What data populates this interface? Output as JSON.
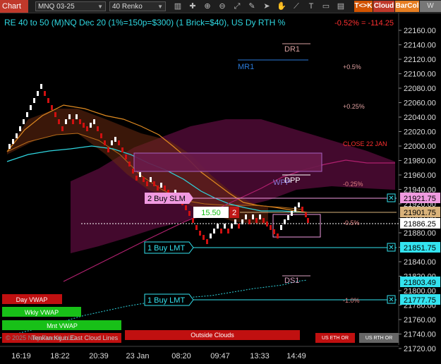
{
  "toolbar": {
    "chart_label": "Chart",
    "symbol": "MNQ 03-25",
    "bar_type": "40 Renko",
    "icons": [
      "bar-chart-icon",
      "crosshair-icon",
      "zoom-in-icon",
      "zoom-out-icon",
      "fit-icon",
      "draw-icon",
      "pointer-icon",
      "hand-icon",
      "trend-icon",
      "text-icon",
      "shapes-icon",
      "data-box-icon"
    ],
    "badges": {
      "tk": "T<>K",
      "cloud": "Cloud",
      "barcol": "BarCol",
      "www": "W VWA"
    }
  },
  "header": {
    "title": "RE 40 to 50 (M)NQ Dec 20 (1%=150p=$300) (1 Brick=$40), US Dy RTH %",
    "pnl": "-0.52% = -114.25"
  },
  "price_axis": {
    "ticks": [
      "22160.00",
      "22140.00",
      "22120.00",
      "22100.00",
      "22080.00",
      "22060.00",
      "22040.00",
      "22020.00",
      "22000.00",
      "21980.00",
      "21960.00",
      "21940.00",
      "21920.00",
      "21900.00",
      "21880.00",
      "21860.00",
      "21840.00",
      "21820.00",
      "21800.00",
      "21780.00",
      "21760.00",
      "21740.00",
      "21720.00"
    ],
    "markers": [
      {
        "label": "21921.75",
        "color": "#f09ae0"
      },
      {
        "label": "21901.75",
        "color": "#d9b27a"
      },
      {
        "label": "21886.25",
        "color": "#ffffff"
      },
      {
        "label": "21851.75",
        "color": "#33e3f0"
      },
      {
        "label": "21803.49",
        "color": "#33e3f0"
      },
      {
        "label": "21777.75",
        "color": "#33e3f0"
      }
    ]
  },
  "time_axis": [
    "16:19",
    "18:22",
    "20:39",
    "23 Jan",
    "08:20",
    "09:47",
    "13:33",
    "14:49"
  ],
  "levels": {
    "dr1": "DR1",
    "mr1": "MR1",
    "dpp": "DPP",
    "wpp": "WPP",
    "ds1": "DS1",
    "p05": "+0.5%",
    "p025": "+0.25%",
    "close": "CLOSE 22 JAN",
    "m025": "-0.25%",
    "m05": "-0.5%",
    "m10": "-1.0%"
  },
  "orders": {
    "buy_slm": "2 Buy SLM",
    "buy_lmt1": "1 Buy LMT",
    "buy_lmt2": "1 Buy LMT",
    "cancel": "✕"
  },
  "position": {
    "value": "15.50",
    "qty": "2"
  },
  "status_bars": {
    "day_vwap": "Day VWAP",
    "wkly_vwap": "Wkly VWAP",
    "mnt_vwap": "Mnt VWAP",
    "watermark": "© 2025 NinjaTrader, LLC",
    "cloud_lines": "Tenkan Kijun East Cloud Lines",
    "outside_clouds": "Outside Clouds",
    "us_eth": "US ETH OR",
    "us_rth": "US RTH OR"
  },
  "colors": {
    "up_brick": "#ffffff",
    "down_brick": "#d01010",
    "cloud": "#5a0a3a",
    "orange_line": "#e08a20",
    "cyan_line": "#2fd6e0",
    "magenta_line": "#b0206e"
  }
}
